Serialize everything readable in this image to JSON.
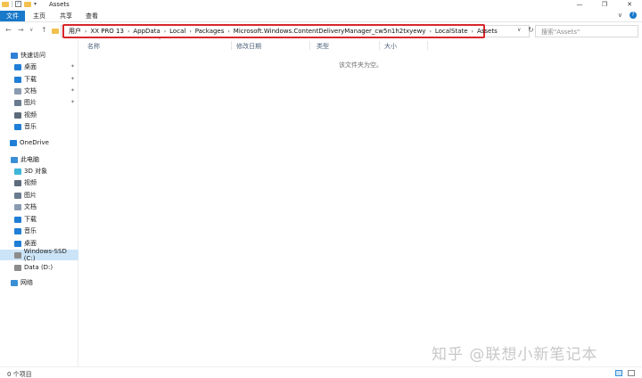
{
  "window": {
    "title": "Assets",
    "minimize": "—",
    "restore": "❐",
    "close": "✕",
    "qa_check": "✓",
    "qa_dropdown": "▾"
  },
  "ribbon": {
    "tabs": [
      {
        "label": "文件"
      },
      {
        "label": "主页"
      },
      {
        "label": "共享"
      },
      {
        "label": "查看"
      }
    ],
    "expand_chevron": "∨",
    "help": "?"
  },
  "address": {
    "breadcrumbs": [
      "用户",
      "XX PRO 13",
      "AppData",
      "Local",
      "Packages",
      "Microsoft.Windows.ContentDeliveryManager_cw5n1h2txyewy",
      "LocalState",
      "Assets"
    ],
    "separator": "›",
    "back": "←",
    "forward": "→",
    "recent": "∨",
    "up": "↑",
    "dropdown": "∨",
    "refresh": "↻",
    "highlight_color": "#d9262b"
  },
  "search": {
    "placeholder": "搜索\"Assets\"",
    "icon": "⌕"
  },
  "sidebar": {
    "pin_glyph": "✦",
    "items": [
      {
        "label": "快速访问",
        "icon": "star-icon",
        "color": "#2f7fd6",
        "pinned": false
      },
      {
        "label": "桌面",
        "icon": "desktop-icon",
        "color": "#1f7ed6",
        "pinned": true
      },
      {
        "label": "下载",
        "icon": "download-icon",
        "color": "#1f7ed6",
        "pinned": true
      },
      {
        "label": "文档",
        "icon": "document-icon",
        "color": "#8a9bb0",
        "pinned": true
      },
      {
        "label": "图片",
        "icon": "picture-icon",
        "color": "#6a7b8e",
        "pinned": true
      },
      {
        "label": "视频",
        "icon": "video-icon",
        "color": "#5c6b7a",
        "pinned": false
      },
      {
        "label": "音乐",
        "icon": "music-icon",
        "color": "#1f7ed6",
        "pinned": false
      },
      {
        "label": "OneDrive",
        "icon": "cloud-icon",
        "color": "#1f7ed6",
        "pinned": false
      },
      {
        "label": "此电脑",
        "icon": "computer-icon",
        "color": "#3a8fd6",
        "pinned": false
      },
      {
        "label": "3D 对象",
        "icon": "cube-icon",
        "color": "#3fb6d8",
        "pinned": false
      },
      {
        "label": "视频",
        "icon": "video-icon",
        "color": "#5c6b7a",
        "pinned": false
      },
      {
        "label": "图片",
        "icon": "picture-icon",
        "color": "#6a7b8e",
        "pinned": false
      },
      {
        "label": "文档",
        "icon": "document-icon",
        "color": "#8a9bb0",
        "pinned": false
      },
      {
        "label": "下载",
        "icon": "download-icon",
        "color": "#1f7ed6",
        "pinned": false
      },
      {
        "label": "音乐",
        "icon": "music-icon",
        "color": "#1f7ed6",
        "pinned": false
      },
      {
        "label": "桌面",
        "icon": "desktop-icon",
        "color": "#1f7ed6",
        "pinned": false
      },
      {
        "label": "Windows-SSD (C:)",
        "icon": "drive-icon",
        "color": "#8c8c8c",
        "pinned": false,
        "selected": true
      },
      {
        "label": "Data (D:)",
        "icon": "drive-icon",
        "color": "#8c8c8c",
        "pinned": false
      },
      {
        "label": "网络",
        "icon": "network-icon",
        "color": "#3a8fd6",
        "pinned": false
      }
    ]
  },
  "columns": [
    {
      "label": "名称"
    },
    {
      "label": "修改日期"
    },
    {
      "label": "类型"
    },
    {
      "label": "大小"
    }
  ],
  "empty_message": "该文件夹为空。",
  "watermark": "知乎 @联想小新笔记本",
  "status": {
    "item_count": "0 个项目"
  }
}
